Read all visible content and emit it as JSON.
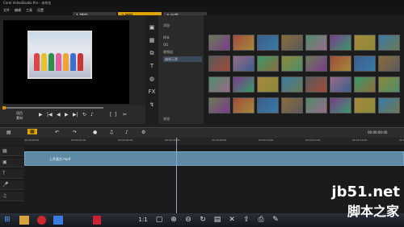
{
  "app": {
    "title": "Corel VideoStudio Pro - 未命名"
  },
  "menu": [
    "文件",
    "编辑",
    "工具",
    "设置"
  ],
  "steps": [
    {
      "label": "1 捕获"
    },
    {
      "label": "2 编辑"
    },
    {
      "label": "3 分享"
    }
  ],
  "player": {
    "mode_label": "项目",
    "mode_label2": "素材",
    "timecode": "00:00:00:00"
  },
  "library": {
    "add_label": "添加",
    "items": [
      "样本",
      "OO",
      "视频组",
      "编辑元素"
    ],
    "browse_label": "浏览"
  },
  "timeline": {
    "clip_title": "上升画方.mp4",
    "ruler": [
      "00:00:00:00",
      "00:00:02:00",
      "00:00:04:00",
      "00:00:06:00",
      "00:00:08:00",
      "00:00:10:00",
      "00:00:12:00",
      "00:00:14:00",
      "00:00:16:00"
    ],
    "zoom": "00:00:00:00"
  },
  "taskbar": {
    "items": [
      "windows-logo",
      "1:1"
    ]
  },
  "watermark": {
    "line1": "jb51.net",
    "line2": "脚本之家"
  }
}
